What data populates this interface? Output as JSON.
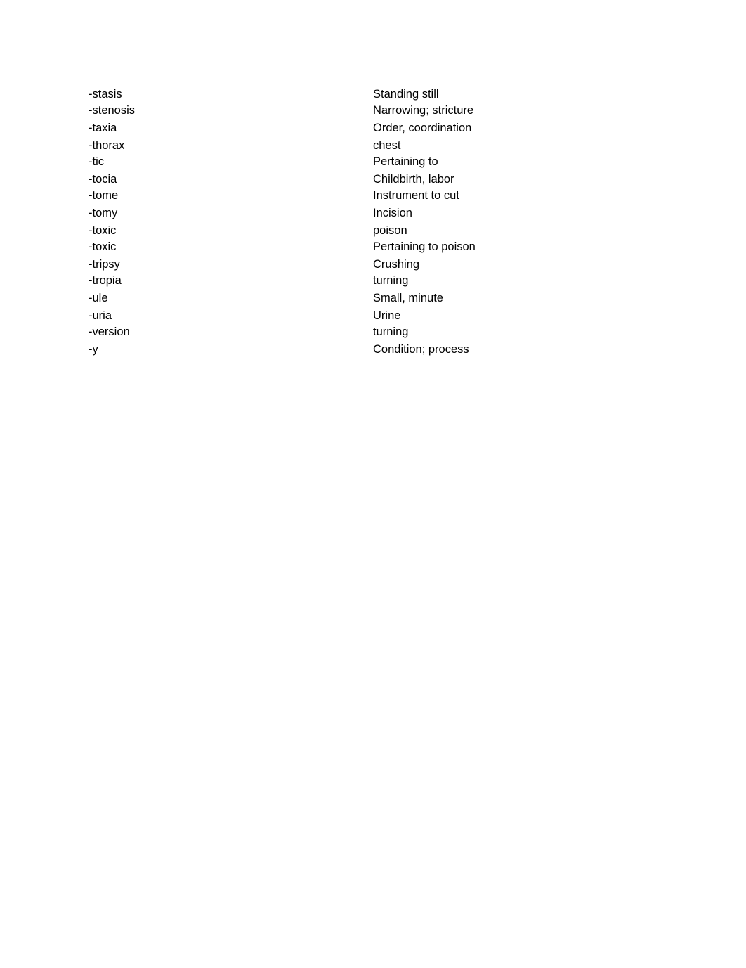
{
  "document": {
    "rows": [
      {
        "term": "-stasis",
        "meaning": "Standing still"
      },
      {
        "term": "-stenosis",
        "meaning": "Narrowing; stricture"
      },
      {
        "term": "-taxia",
        "meaning": "Order, coordination"
      },
      {
        "term": "-thorax",
        "meaning": "chest"
      },
      {
        "term": "-tic",
        "meaning": "Pertaining to"
      },
      {
        "term": "-tocia",
        "meaning": "Childbirth, labor"
      },
      {
        "term": "-tome",
        "meaning": "Instrument to cut"
      },
      {
        "term": "-tomy",
        "meaning": "Incision"
      },
      {
        "term": "-toxic",
        "meaning": "poison"
      },
      {
        "term": "-toxic",
        "meaning": "Pertaining to poison"
      },
      {
        "term": "-tripsy",
        "meaning": "Crushing"
      },
      {
        "term": "-tropia",
        "meaning": "turning"
      },
      {
        "term": "-ule",
        "meaning": "Small, minute"
      },
      {
        "term": "-uria",
        "meaning": "Urine"
      },
      {
        "term": "-version",
        "meaning": "turning"
      },
      {
        "term": "-y",
        "meaning": "Condition; process"
      }
    ]
  }
}
